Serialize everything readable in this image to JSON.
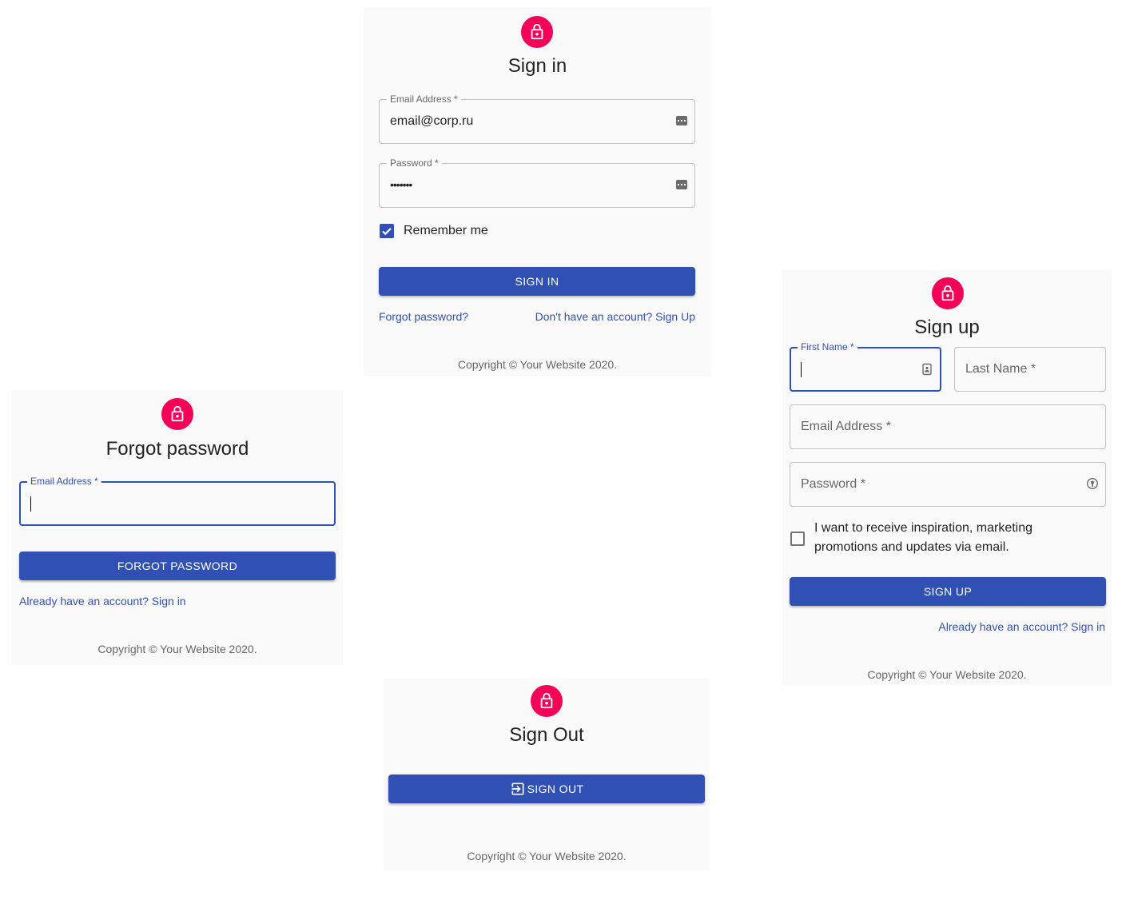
{
  "colors": {
    "primary": "#3051b3",
    "avatar": "#f50057",
    "panel": "#fafafa"
  },
  "signin": {
    "title": "Sign in",
    "email": {
      "label": "Email Address *",
      "value": "email@corp.ru"
    },
    "password": {
      "label": "Password *",
      "value": "•••••••"
    },
    "remember_label": "Remember me",
    "remember_checked": true,
    "button": "SIGN IN",
    "forgot_link": "Forgot password?",
    "signup_link": "Don't have an account? Sign Up",
    "copyright": "Copyright © Your Website 2020."
  },
  "forgot": {
    "title": "Forgot password",
    "email": {
      "label": "Email Address *",
      "value": ""
    },
    "button": "FORGOT PASSWORD",
    "signin_link": "Already have an account? Sign in",
    "copyright": "Copyright © Your Website 2020."
  },
  "signup": {
    "title": "Sign up",
    "first_name": {
      "label": "First Name *",
      "value": ""
    },
    "last_name": {
      "placeholder": "Last Name *"
    },
    "email": {
      "placeholder": "Email Address *"
    },
    "password": {
      "placeholder": "Password *"
    },
    "marketing_line1": "I want to receive inspiration, marketing",
    "marketing_line2": "promotions and updates via email.",
    "marketing_checked": false,
    "button": "SIGN UP",
    "signin_link": "Already have an account? Sign in",
    "copyright": "Copyright © Your Website 2020."
  },
  "signout": {
    "title": "Sign Out",
    "button": "SIGN OUT",
    "copyright": "Copyright © Your Website 2020."
  }
}
